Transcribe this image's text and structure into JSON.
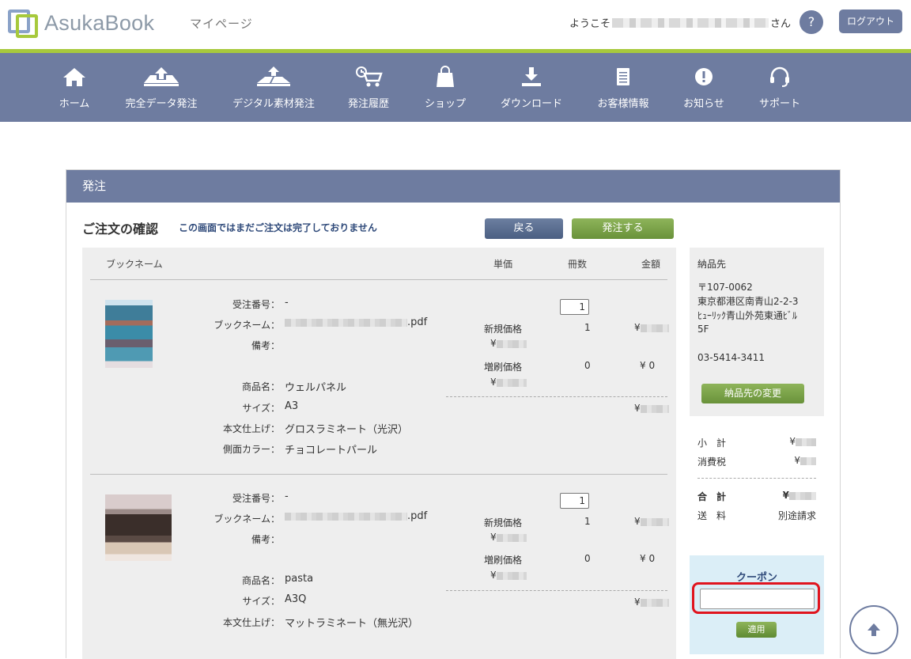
{
  "header": {
    "logo_text": "AsukaBook",
    "mypage": "マイページ",
    "welcome_prefix": "ようこそ",
    "welcome_suffix": "さん",
    "help": "?",
    "logout": "ログアウト"
  },
  "nav": [
    {
      "label": "ホーム",
      "icon": "home-icon"
    },
    {
      "label": "完全データ発注",
      "icon": "upload-tray-icon"
    },
    {
      "label": "デジタル素材発注",
      "icon": "digital-upload-icon"
    },
    {
      "label": "発注履歴",
      "icon": "cart-history-icon"
    },
    {
      "label": "ショップ",
      "icon": "shopping-bag-icon"
    },
    {
      "label": "ダウンロード",
      "icon": "download-icon"
    },
    {
      "label": "お客様情報",
      "icon": "document-icon"
    },
    {
      "label": "お知らせ",
      "icon": "exclamation-icon"
    },
    {
      "label": "サポート",
      "icon": "headset-icon"
    }
  ],
  "panel": {
    "title": "発注",
    "confirm_title": "ご注文の確認",
    "confirm_note": "この画面ではまだご注文は完了しておりません",
    "back": "戻る",
    "order": "発注する"
  },
  "table": {
    "headers": {
      "book": "ブックネーム",
      "unit": "単価",
      "count": "冊数",
      "amount": "金額"
    },
    "labels": {
      "order_no": "受注番号：",
      "book_name": "ブックネーム：",
      "note": "備考：",
      "product": "商品名：",
      "size": "サイズ：",
      "finish": "本文仕上げ：",
      "side_color": "側面カラー："
    },
    "items": [
      {
        "order_no": "-",
        "book_ext": ".pdf",
        "product": "ウェルパネル",
        "size": "A3",
        "finish": "グロスラミネート（光沢）",
        "side_color": "チョコレートパール",
        "qty": "1",
        "new_price_label": "新規価格",
        "new_count": "1",
        "reprint_label": "増刷価格",
        "reprint_count": "0",
        "reprint_amount": "¥ 0",
        "yen": "¥"
      },
      {
        "order_no": "-",
        "book_ext": ".pdf",
        "product": "pasta",
        "size": "A3Q",
        "finish": "マットラミネート（無光沢）",
        "qty": "1",
        "new_price_label": "新規価格",
        "new_count": "1",
        "reprint_label": "増刷価格",
        "reprint_count": "0",
        "reprint_amount": "¥ 0",
        "yen": "¥"
      }
    ]
  },
  "shipping": {
    "title": "納品先",
    "postal": "〒107-0062",
    "line1": "東京都港区南青山2-2-3",
    "line2": "ﾋｭｰﾘｯｸ青山外苑東通ﾋﾞﾙ",
    "line3": "5F",
    "phone": "03-5414-3411",
    "change": "納品先の変更"
  },
  "summary": {
    "subtotal": "小　計",
    "tax": "消費税",
    "total": "合　計",
    "shipping": "送　料",
    "shipping_value": "別途請求",
    "yen": "¥"
  },
  "coupon": {
    "title": "クーポン",
    "value": "",
    "apply": "適用"
  },
  "colors": {
    "nav_bg": "#6e7ca0",
    "accent_green": "#a7c93c",
    "button_green": "#7aa24a",
    "coupon_bg": "#dbeef7",
    "highlight_red": "#e0141e"
  }
}
